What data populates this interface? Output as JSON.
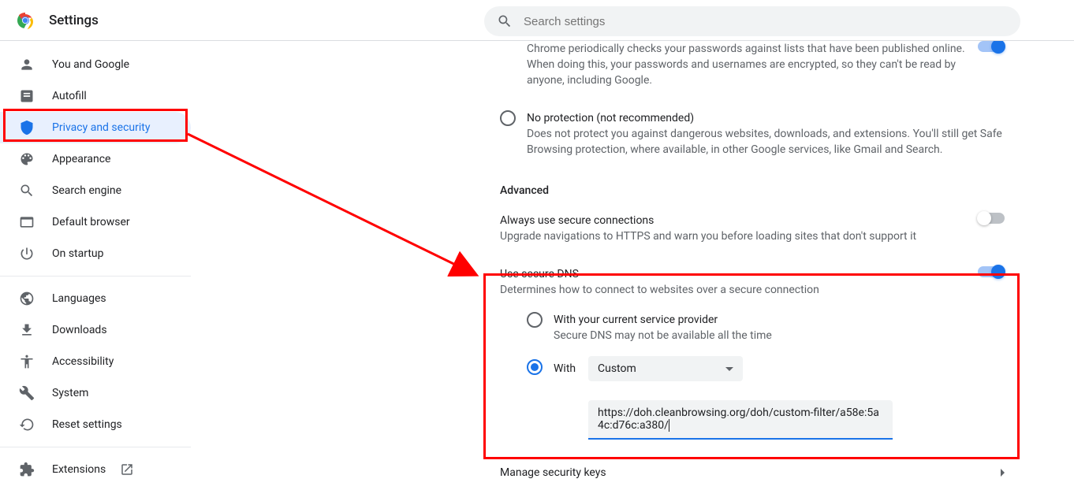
{
  "header": {
    "title": "Settings",
    "search_placeholder": "Search settings"
  },
  "sidebar": {
    "items": [
      {
        "label": "You and Google",
        "icon": "person"
      },
      {
        "label": "Autofill",
        "icon": "autofill"
      },
      {
        "label": "Privacy and security",
        "icon": "shield",
        "selected": true
      },
      {
        "label": "Appearance",
        "icon": "palette"
      },
      {
        "label": "Search engine",
        "icon": "search"
      },
      {
        "label": "Default browser",
        "icon": "browser"
      },
      {
        "label": "On startup",
        "icon": "power"
      }
    ],
    "more": [
      {
        "label": "Languages",
        "icon": "globe"
      },
      {
        "label": "Downloads",
        "icon": "download"
      },
      {
        "label": "Accessibility",
        "icon": "accessibility"
      },
      {
        "label": "System",
        "icon": "wrench"
      },
      {
        "label": "Reset settings",
        "icon": "restore"
      }
    ],
    "extensions": {
      "label": "Extensions",
      "icon": "extension"
    }
  },
  "content": {
    "password_check": {
      "description": "Chrome periodically checks your passwords against lists that have been published online. When doing this, your passwords and usernames are encrypted, so they can't be read by anyone, including Google.",
      "toggle_on": true
    },
    "no_protection": {
      "title": "No protection (not recommended)",
      "description": "Does not protect you against dangerous websites, downloads, and extensions. You'll still get Safe Browsing protection, where available, in other Google services, like Gmail and Search.",
      "selected": false
    },
    "advanced_heading": "Advanced",
    "secure_connections": {
      "title": "Always use secure connections",
      "description": "Upgrade navigations to HTTPS and warn you before loading sites that don't support it",
      "toggle_on": false
    },
    "secure_dns": {
      "title": "Use secure DNS",
      "description": "Determines how to connect to websites over a secure connection",
      "toggle_on": true,
      "option_current": {
        "title": "With your current service provider",
        "description": "Secure DNS may not be available all the time",
        "selected": false
      },
      "option_with": {
        "label": "With",
        "selected": true,
        "dropdown_value": "Custom",
        "custom_url": "https://doh.cleanbrowsing.org/doh/custom-filter/a58e:5a4c:d76c:a380/"
      }
    },
    "manage_keys": "Manage security keys"
  }
}
